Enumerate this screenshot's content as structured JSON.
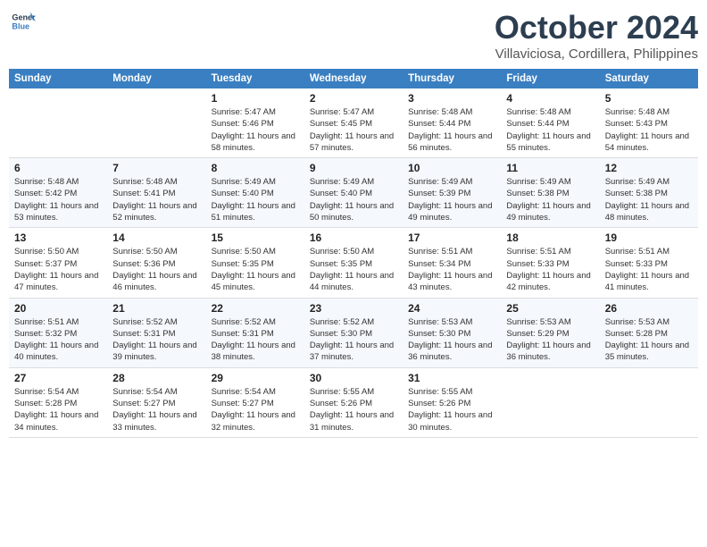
{
  "header": {
    "logo_line1": "General",
    "logo_line2": "Blue",
    "month": "October 2024",
    "location": "Villaviciosa, Cordillera, Philippines"
  },
  "days_of_week": [
    "Sunday",
    "Monday",
    "Tuesday",
    "Wednesday",
    "Thursday",
    "Friday",
    "Saturday"
  ],
  "weeks": [
    [
      {
        "day": "",
        "sunrise": "",
        "sunset": "",
        "daylight": ""
      },
      {
        "day": "",
        "sunrise": "",
        "sunset": "",
        "daylight": ""
      },
      {
        "day": "1",
        "sunrise": "Sunrise: 5:47 AM",
        "sunset": "Sunset: 5:46 PM",
        "daylight": "Daylight: 11 hours and 58 minutes."
      },
      {
        "day": "2",
        "sunrise": "Sunrise: 5:47 AM",
        "sunset": "Sunset: 5:45 PM",
        "daylight": "Daylight: 11 hours and 57 minutes."
      },
      {
        "day": "3",
        "sunrise": "Sunrise: 5:48 AM",
        "sunset": "Sunset: 5:44 PM",
        "daylight": "Daylight: 11 hours and 56 minutes."
      },
      {
        "day": "4",
        "sunrise": "Sunrise: 5:48 AM",
        "sunset": "Sunset: 5:44 PM",
        "daylight": "Daylight: 11 hours and 55 minutes."
      },
      {
        "day": "5",
        "sunrise": "Sunrise: 5:48 AM",
        "sunset": "Sunset: 5:43 PM",
        "daylight": "Daylight: 11 hours and 54 minutes."
      }
    ],
    [
      {
        "day": "6",
        "sunrise": "Sunrise: 5:48 AM",
        "sunset": "Sunset: 5:42 PM",
        "daylight": "Daylight: 11 hours and 53 minutes."
      },
      {
        "day": "7",
        "sunrise": "Sunrise: 5:48 AM",
        "sunset": "Sunset: 5:41 PM",
        "daylight": "Daylight: 11 hours and 52 minutes."
      },
      {
        "day": "8",
        "sunrise": "Sunrise: 5:49 AM",
        "sunset": "Sunset: 5:40 PM",
        "daylight": "Daylight: 11 hours and 51 minutes."
      },
      {
        "day": "9",
        "sunrise": "Sunrise: 5:49 AM",
        "sunset": "Sunset: 5:40 PM",
        "daylight": "Daylight: 11 hours and 50 minutes."
      },
      {
        "day": "10",
        "sunrise": "Sunrise: 5:49 AM",
        "sunset": "Sunset: 5:39 PM",
        "daylight": "Daylight: 11 hours and 49 minutes."
      },
      {
        "day": "11",
        "sunrise": "Sunrise: 5:49 AM",
        "sunset": "Sunset: 5:38 PM",
        "daylight": "Daylight: 11 hours and 49 minutes."
      },
      {
        "day": "12",
        "sunrise": "Sunrise: 5:49 AM",
        "sunset": "Sunset: 5:38 PM",
        "daylight": "Daylight: 11 hours and 48 minutes."
      }
    ],
    [
      {
        "day": "13",
        "sunrise": "Sunrise: 5:50 AM",
        "sunset": "Sunset: 5:37 PM",
        "daylight": "Daylight: 11 hours and 47 minutes."
      },
      {
        "day": "14",
        "sunrise": "Sunrise: 5:50 AM",
        "sunset": "Sunset: 5:36 PM",
        "daylight": "Daylight: 11 hours and 46 minutes."
      },
      {
        "day": "15",
        "sunrise": "Sunrise: 5:50 AM",
        "sunset": "Sunset: 5:35 PM",
        "daylight": "Daylight: 11 hours and 45 minutes."
      },
      {
        "day": "16",
        "sunrise": "Sunrise: 5:50 AM",
        "sunset": "Sunset: 5:35 PM",
        "daylight": "Daylight: 11 hours and 44 minutes."
      },
      {
        "day": "17",
        "sunrise": "Sunrise: 5:51 AM",
        "sunset": "Sunset: 5:34 PM",
        "daylight": "Daylight: 11 hours and 43 minutes."
      },
      {
        "day": "18",
        "sunrise": "Sunrise: 5:51 AM",
        "sunset": "Sunset: 5:33 PM",
        "daylight": "Daylight: 11 hours and 42 minutes."
      },
      {
        "day": "19",
        "sunrise": "Sunrise: 5:51 AM",
        "sunset": "Sunset: 5:33 PM",
        "daylight": "Daylight: 11 hours and 41 minutes."
      }
    ],
    [
      {
        "day": "20",
        "sunrise": "Sunrise: 5:51 AM",
        "sunset": "Sunset: 5:32 PM",
        "daylight": "Daylight: 11 hours and 40 minutes."
      },
      {
        "day": "21",
        "sunrise": "Sunrise: 5:52 AM",
        "sunset": "Sunset: 5:31 PM",
        "daylight": "Daylight: 11 hours and 39 minutes."
      },
      {
        "day": "22",
        "sunrise": "Sunrise: 5:52 AM",
        "sunset": "Sunset: 5:31 PM",
        "daylight": "Daylight: 11 hours and 38 minutes."
      },
      {
        "day": "23",
        "sunrise": "Sunrise: 5:52 AM",
        "sunset": "Sunset: 5:30 PM",
        "daylight": "Daylight: 11 hours and 37 minutes."
      },
      {
        "day": "24",
        "sunrise": "Sunrise: 5:53 AM",
        "sunset": "Sunset: 5:30 PM",
        "daylight": "Daylight: 11 hours and 36 minutes."
      },
      {
        "day": "25",
        "sunrise": "Sunrise: 5:53 AM",
        "sunset": "Sunset: 5:29 PM",
        "daylight": "Daylight: 11 hours and 36 minutes."
      },
      {
        "day": "26",
        "sunrise": "Sunrise: 5:53 AM",
        "sunset": "Sunset: 5:28 PM",
        "daylight": "Daylight: 11 hours and 35 minutes."
      }
    ],
    [
      {
        "day": "27",
        "sunrise": "Sunrise: 5:54 AM",
        "sunset": "Sunset: 5:28 PM",
        "daylight": "Daylight: 11 hours and 34 minutes."
      },
      {
        "day": "28",
        "sunrise": "Sunrise: 5:54 AM",
        "sunset": "Sunset: 5:27 PM",
        "daylight": "Daylight: 11 hours and 33 minutes."
      },
      {
        "day": "29",
        "sunrise": "Sunrise: 5:54 AM",
        "sunset": "Sunset: 5:27 PM",
        "daylight": "Daylight: 11 hours and 32 minutes."
      },
      {
        "day": "30",
        "sunrise": "Sunrise: 5:55 AM",
        "sunset": "Sunset: 5:26 PM",
        "daylight": "Daylight: 11 hours and 31 minutes."
      },
      {
        "day": "31",
        "sunrise": "Sunrise: 5:55 AM",
        "sunset": "Sunset: 5:26 PM",
        "daylight": "Daylight: 11 hours and 30 minutes."
      },
      {
        "day": "",
        "sunrise": "",
        "sunset": "",
        "daylight": ""
      },
      {
        "day": "",
        "sunrise": "",
        "sunset": "",
        "daylight": ""
      }
    ]
  ]
}
